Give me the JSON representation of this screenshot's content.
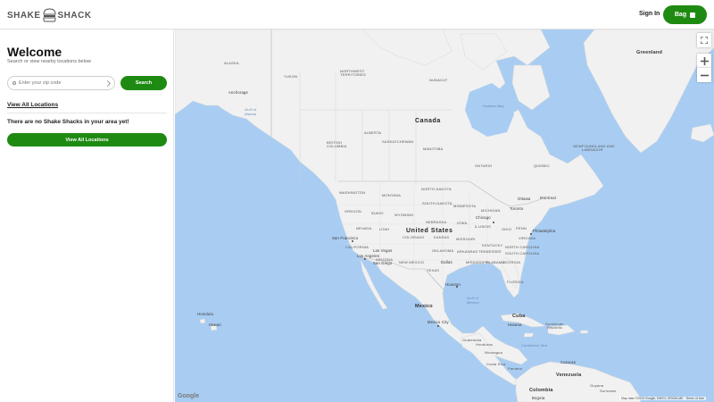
{
  "header": {
    "logo_left": "SHAKE",
    "logo_right": "SHACK",
    "signin_label": "Sign In",
    "bag_label": "Bag"
  },
  "sidebar": {
    "title": "Welcome",
    "subtitle": "Search or view nearby locations below",
    "zip_placeholder": "Enter your zip code",
    "search_label": "Search",
    "view_all_link": "View All Locations",
    "no_results": "There are no Shake Shacks in your area yet!",
    "view_all_button": "View All Locations"
  },
  "map": {
    "countries": {
      "canada": "Canada",
      "us": "United States",
      "mexico": "Mexico",
      "greenland": "Greenland",
      "alaska": "ALASKA",
      "cuba": "Cuba",
      "dominican": "Dominican",
      "republic": "Republic",
      "guatemala": "Guatemala",
      "honduras": "Honduras",
      "nicaragua": "Nicaragua",
      "costa_rica": "Costa Rica",
      "panama": "Panama",
      "venezuela": "Venezuela",
      "colombia": "Colombia",
      "guyana": "Guyana",
      "suriname": "Suriname"
    },
    "regions": {
      "yukon": "YUKON",
      "nwt_1": "NORTHWEST",
      "nwt_2": "TERRITORIES",
      "nunavut": "NUNAVUT",
      "bc_1": "BRITISH",
      "bc_2": "COLUMBIA",
      "alberta": "ALBERTA",
      "sask": "SASKATCHEWAN",
      "manitoba": "MANITOBA",
      "ontario": "ONTARIO",
      "quebec": "QUEBEC",
      "nl_1": "NEWFOUNDLAND AND",
      "nl_2": "LABRADOR",
      "washington": "WASHINGTON",
      "montana": "MONTANA",
      "nd": "NORTH DAKOTA",
      "sd": "SOUTH DAKOTA",
      "oregon": "OREGON",
      "idaho": "IDAHO",
      "wyoming": "WYOMING",
      "nebraska": "NEBRASKA",
      "nevada": "NEVADA",
      "utah": "UTAH",
      "colorado": "COLORADO",
      "kansas": "KANSAS",
      "california": "CALIFORNIA",
      "arizona": "ARIZONA",
      "new_mexico": "NEW MEXICO",
      "oklahoma": "OKLAHOMA",
      "texas": "TEXAS",
      "minnesota": "MINNESOTA",
      "iowa": "IOWA",
      "missouri": "MISSOURI",
      "illinois": "ILLINOIS",
      "kentucky": "KENTUCKY",
      "tennessee": "TENNESSEE",
      "arkansas": "ARKANSAS",
      "mississippi": "MISSISSIPPI",
      "alabama": "ALABAMA",
      "georgia": "GEORGIA",
      "florida": "FLORIDA",
      "virginia": "VIRGINIA",
      "nc": "NORTH CAROLINA",
      "sc": "SOUTH CAROLINA",
      "penn": "PENN",
      "ohio": "OHIO",
      "michigan": "MICHIGAN"
    },
    "cities": {
      "anchorage": "Anchorage",
      "chicago": "Chicago",
      "toronto": "Toronto",
      "ottawa": "Ottawa",
      "montreal": "Montreal",
      "philadelphia": "Philadelphia",
      "san_francisco": "San Francisco",
      "las_vegas": "Las Vegas",
      "los_angeles": "Los Angeles",
      "san_diego": "San Diego",
      "dallas": "Dallas",
      "houston": "Houston",
      "mexico_city": "Mexico City",
      "havana": "Havana",
      "caracas": "Caracas",
      "bogota": "Bogota",
      "honolulu": "Honolulu",
      "hawaii": "Hawaii"
    },
    "water": {
      "hudson_bay": "Hudson Bay",
      "gulf_alaska_1": "Gulf of",
      "gulf_alaska_2": "Alaska",
      "gulf_mexico_1": "Gulf of",
      "gulf_mexico_2": "Mexico",
      "caribbean": "Caribbean Sea"
    },
    "google_logo": "Google",
    "attribution": "Map data ©2019 Google, INEGI, ORION-ME",
    "terms": "Terms of Use"
  },
  "colors": {
    "brand_green": "#1f8a12",
    "water": "#a9cdf2",
    "land": "#f1f1f1"
  }
}
